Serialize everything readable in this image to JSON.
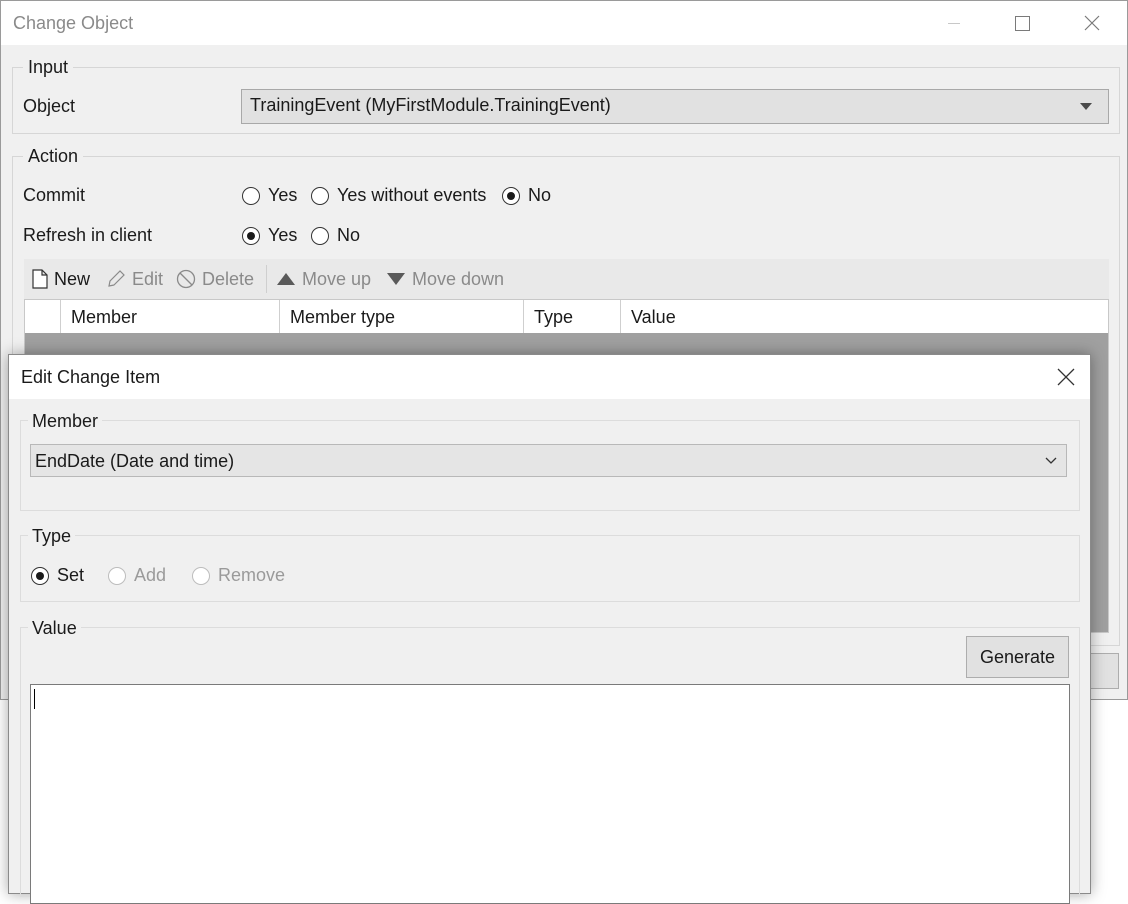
{
  "window": {
    "title": "Change Object"
  },
  "input_group": {
    "label": "Input",
    "object_label": "Object",
    "object_value": "TrainingEvent (MyFirstModule.TrainingEvent)"
  },
  "action_group": {
    "label": "Action",
    "commit_label": "Commit",
    "commit_options": [
      "Yes",
      "Yes without events",
      "No"
    ],
    "commit_selected": "No",
    "refresh_label": "Refresh in client",
    "refresh_options": [
      "Yes",
      "No"
    ],
    "refresh_selected": "Yes"
  },
  "toolbar": {
    "new_label": "New",
    "edit_label": "Edit",
    "delete_label": "Delete",
    "move_up_label": "Move up",
    "move_down_label": "Move down"
  },
  "grid": {
    "columns": [
      "Member",
      "Member type",
      "Type",
      "Value"
    ]
  },
  "dialog": {
    "title": "Edit Change Item",
    "member_group_label": "Member",
    "member_value": "EndDate (Date and time)",
    "type_group_label": "Type",
    "type_options": [
      "Set",
      "Add",
      "Remove"
    ],
    "type_selected": "Set",
    "value_group_label": "Value",
    "generate_label": "Generate",
    "value_text": ""
  }
}
